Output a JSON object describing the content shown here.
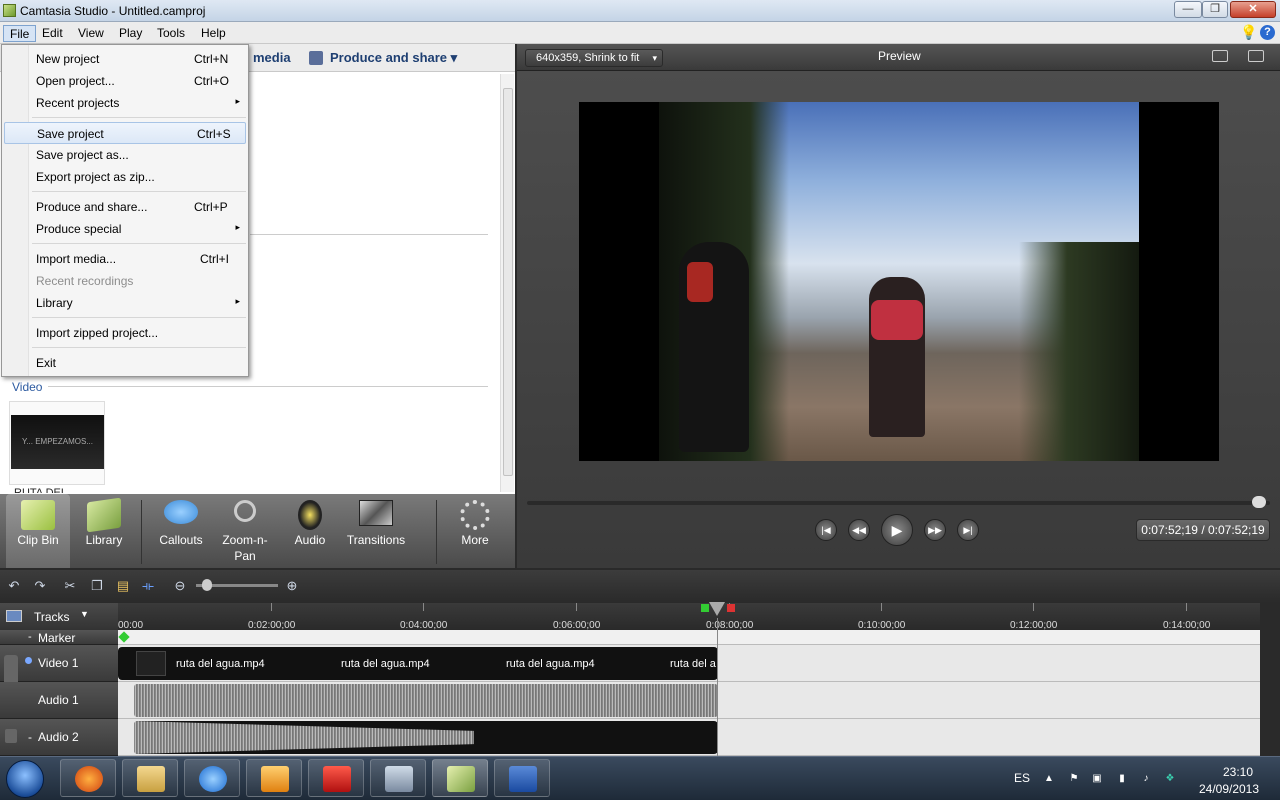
{
  "window": {
    "title": "Camtasia Studio - Untitled.camproj",
    "minimize": "—",
    "maximize": "❐",
    "close": "✕"
  },
  "menubar": [
    "File",
    "Edit",
    "View",
    "Play",
    "Tools",
    "Help"
  ],
  "top_tabs": {
    "import_partial": "media",
    "produce": "Produce and share ▾"
  },
  "file_menu": [
    {
      "label": "New project",
      "shortcut": "Ctrl+N"
    },
    {
      "label": "Open project...",
      "shortcut": "Ctrl+O"
    },
    {
      "label": "Recent projects",
      "arrow": "▸"
    },
    {
      "label": "Save project",
      "shortcut": "Ctrl+S"
    },
    {
      "label": "Save project as..."
    },
    {
      "label": "Export project as zip..."
    },
    {
      "label": "Produce and share...",
      "shortcut": "Ctrl+P"
    },
    {
      "label": "Produce special",
      "arrow": "▸"
    },
    {
      "label": "Import media...",
      "shortcut": "Ctrl+I"
    },
    {
      "label": "Recent recordings"
    },
    {
      "label": "Library",
      "arrow": "▸"
    },
    {
      "label": "Import zipped project..."
    },
    {
      "label": "Exit"
    }
  ],
  "clipbin": {
    "section_video": "Video",
    "clip_thumb_text": "Y... EMPEZAMOS...",
    "clip_name": "RUTA DEL"
  },
  "tools": [
    "Clip Bin",
    "Library",
    "Callouts",
    "Zoom-n-\nPan",
    "Audio",
    "Transitions",
    "More"
  ],
  "preview": {
    "size_dropdown": "640x359, Shrink to fit",
    "title": "Preview",
    "timecode": "0:07:52;19 / 0:07:52;19"
  },
  "timeline": {
    "tracks_label": "Tracks",
    "ticks": [
      "00:00",
      "0:02:00;00",
      "0:04:00;00",
      "0:06:00;00",
      "0:08:00;00",
      "0:10:00;00",
      "0:12:00;00",
      "0:14:00;00"
    ],
    "tracks": [
      {
        "name": "Marker"
      },
      {
        "name": "Video 1"
      },
      {
        "name": "Audio 1"
      },
      {
        "name": "Audio 2"
      }
    ],
    "video_clips": [
      "ruta del agua.mp4",
      "ruta del agua.mp4",
      "ruta del agua.mp4",
      "ruta del a"
    ]
  },
  "taskbar": {
    "lang": "ES",
    "time": "23:10",
    "date": "24/09/2013"
  }
}
